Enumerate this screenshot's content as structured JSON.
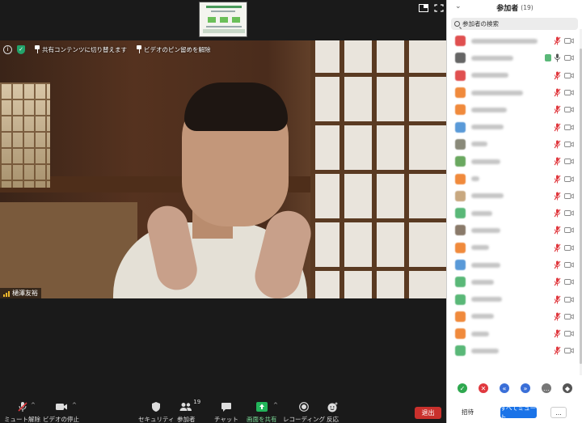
{
  "meeting": {
    "video_toolbar": {
      "info_icon": "info-icon",
      "shield_icon": "shield-icon",
      "switch_shared_content_label": "共有コンテンツに切り替えます",
      "unpin_video_label": "ビデオのピン留めを解除"
    },
    "speaker_name": "樋澤友裕"
  },
  "toolbar": {
    "unmute_label": "ミュート解除",
    "stop_video_label": "ビデオの停止",
    "security_label": "セキュリティ",
    "participants_label": "参加者",
    "participants_count": "19",
    "chat_label": "チャット",
    "share_screen_label": "画面を共有",
    "record_label": "レコーディング",
    "reactions_label": "反応",
    "leave_label": "退出"
  },
  "panel": {
    "title": "参加者",
    "count": "(19)",
    "search_placeholder": "参加者の検索",
    "participants": [
      {
        "color": "#e05050",
        "name_w": 82,
        "mic": "muted",
        "cam": "off"
      },
      {
        "color": "#666666",
        "name_w": 52,
        "mic": "active",
        "cam": "off"
      },
      {
        "color": "#e05050",
        "name_w": 46,
        "mic": "muted",
        "cam": "off"
      },
      {
        "color": "#f08a3c",
        "name_w": 64,
        "mic": "muted",
        "cam": "off"
      },
      {
        "color": "#f08a3c",
        "name_w": 44,
        "mic": "muted",
        "cam": "off"
      },
      {
        "color": "#5a9ad8",
        "name_w": 40,
        "mic": "muted",
        "cam": "off"
      },
      {
        "color": "#8a8a7a",
        "name_w": 20,
        "mic": "muted",
        "cam": "off"
      },
      {
        "color": "#6aa860",
        "name_w": 36,
        "mic": "muted",
        "cam": "off"
      },
      {
        "color": "#f08a3c",
        "name_w": 10,
        "mic": "muted",
        "cam": "off"
      },
      {
        "color": "#c8a880",
        "name_w": 40,
        "mic": "muted",
        "cam": "off"
      },
      {
        "color": "#5ab878",
        "name_w": 26,
        "mic": "muted",
        "cam": "off"
      },
      {
        "color": "#8a7a6a",
        "name_w": 36,
        "mic": "muted",
        "cam": "off"
      },
      {
        "color": "#f08a3c",
        "name_w": 22,
        "mic": "muted",
        "cam": "off"
      },
      {
        "color": "#5a9ad8",
        "name_w": 36,
        "mic": "muted",
        "cam": "off"
      },
      {
        "color": "#5ab878",
        "name_w": 28,
        "mic": "muted",
        "cam": "off"
      },
      {
        "color": "#5ab878",
        "name_w": 38,
        "mic": "muted",
        "cam": "off"
      },
      {
        "color": "#f08a3c",
        "name_w": 28,
        "mic": "muted",
        "cam": "off"
      },
      {
        "color": "#f08a3c",
        "name_w": 22,
        "mic": "muted",
        "cam": "off"
      },
      {
        "color": "#5ab878",
        "name_w": 34,
        "mic": "muted",
        "cam": "off"
      }
    ],
    "reactions": [
      {
        "icon": "yes-icon",
        "color": "#2fa84f",
        "glyph": "✓"
      },
      {
        "icon": "no-icon",
        "color": "#e0383e",
        "glyph": "✕"
      },
      {
        "icon": "slower-icon",
        "color": "#3a6fd8",
        "glyph": "«"
      },
      {
        "icon": "faster-icon",
        "color": "#3a6fd8",
        "glyph": "»"
      },
      {
        "icon": "more-reactions-icon",
        "color": "#777777",
        "glyph": "…"
      },
      {
        "icon": "clear-icon",
        "color": "#555555",
        "glyph": "◆"
      }
    ],
    "invite_label": "招待",
    "mute_all_label": "すべてミュート",
    "more_label": "..."
  },
  "colors": {
    "leave": "#c9302c",
    "mute_all": "#1a73e8",
    "share_screen": "#22b55a",
    "muted_mic": "#e0383e"
  }
}
